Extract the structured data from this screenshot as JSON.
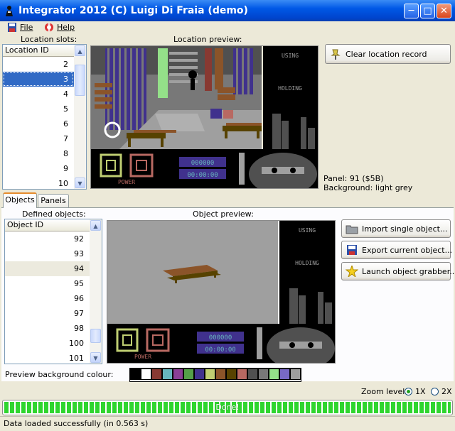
{
  "window": {
    "title": "Integrator 2012 (C) Luigi Di Fraia (demo)",
    "minimize": "─",
    "maximize": "□",
    "close": "✕"
  },
  "menu": {
    "file": "File",
    "help": "Help"
  },
  "location": {
    "slots_label": "Location slots:",
    "preview_label": "Location preview:",
    "list_header": "Location ID",
    "rows": [
      "2",
      "3",
      "4",
      "5",
      "6",
      "7",
      "8",
      "9",
      "10"
    ],
    "selected": "3",
    "clear_button": "Clear location record",
    "panel_info": "Panel: 91 ($5B)",
    "background_info": "Background: light grey"
  },
  "tabs": {
    "objects": "Objects",
    "panels": "Panels"
  },
  "objects": {
    "defined_label": "Defined objects:",
    "preview_label": "Object preview:",
    "list_header": "Object ID",
    "rows": [
      "92",
      "93",
      "94",
      "95",
      "96",
      "97",
      "98",
      "100",
      "101"
    ],
    "highlighted": "94",
    "import_button": "Import single object...",
    "export_button": "Export current object...",
    "grabber_button": "Launch object grabber..."
  },
  "hud": {
    "using": "USING",
    "holding": "HOLDING",
    "power": "POWER",
    "score": "000000",
    "timer": "00:00:00"
  },
  "preview_bg": {
    "label": "Preview background colour:",
    "colors": [
      "#000000",
      "#ffffff",
      "#883932",
      "#67b6bd",
      "#8b3f96",
      "#55a049",
      "#40318d",
      "#bfce72",
      "#8b5429",
      "#574200",
      "#b86962",
      "#505050",
      "#787878",
      "#94e089",
      "#7869c4",
      "#9f9f9f"
    ]
  },
  "zoom": {
    "label": "Zoom level:",
    "opt1": "1X",
    "opt2": "2X",
    "selected": "1X"
  },
  "progress": {
    "text": "Done!",
    "percent": 100
  },
  "status": {
    "text": "Data loaded successfully (in 0.563 s)"
  },
  "colors": {
    "title_bar": "#0058e6",
    "selection": "#316ac5",
    "progress": "#2fd52f",
    "tab_accent": "#e68b2c"
  }
}
